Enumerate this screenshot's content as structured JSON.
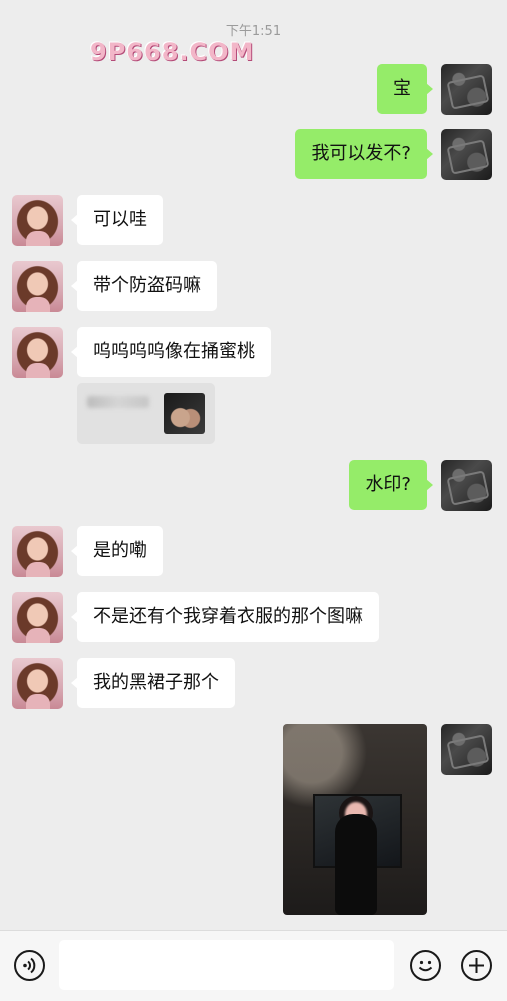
{
  "status": {
    "time": "下午1:51"
  },
  "watermark": {
    "top_left": "9P668.COM"
  },
  "messages": [
    {
      "side": "out",
      "text": "宝"
    },
    {
      "side": "out",
      "text": "我可以发不?"
    },
    {
      "side": "in",
      "text": "可以哇"
    },
    {
      "side": "in",
      "text": "带个防盗码嘛"
    },
    {
      "side": "in",
      "text": "呜呜呜呜像在捅蜜桃"
    },
    {
      "side": "in",
      "type": "quote"
    },
    {
      "side": "out",
      "text": "水印?"
    },
    {
      "side": "in",
      "text": "是的嘞"
    },
    {
      "side": "in",
      "text": "不是还有个我穿着衣服的那个图嘛"
    },
    {
      "side": "in",
      "text": "我的黑裙子那个"
    },
    {
      "side": "out",
      "type": "image"
    }
  ],
  "input": {
    "placeholder": ""
  },
  "icons": {
    "voice": "voice-icon",
    "emoji": "emoji-icon",
    "plus": "plus-icon"
  }
}
